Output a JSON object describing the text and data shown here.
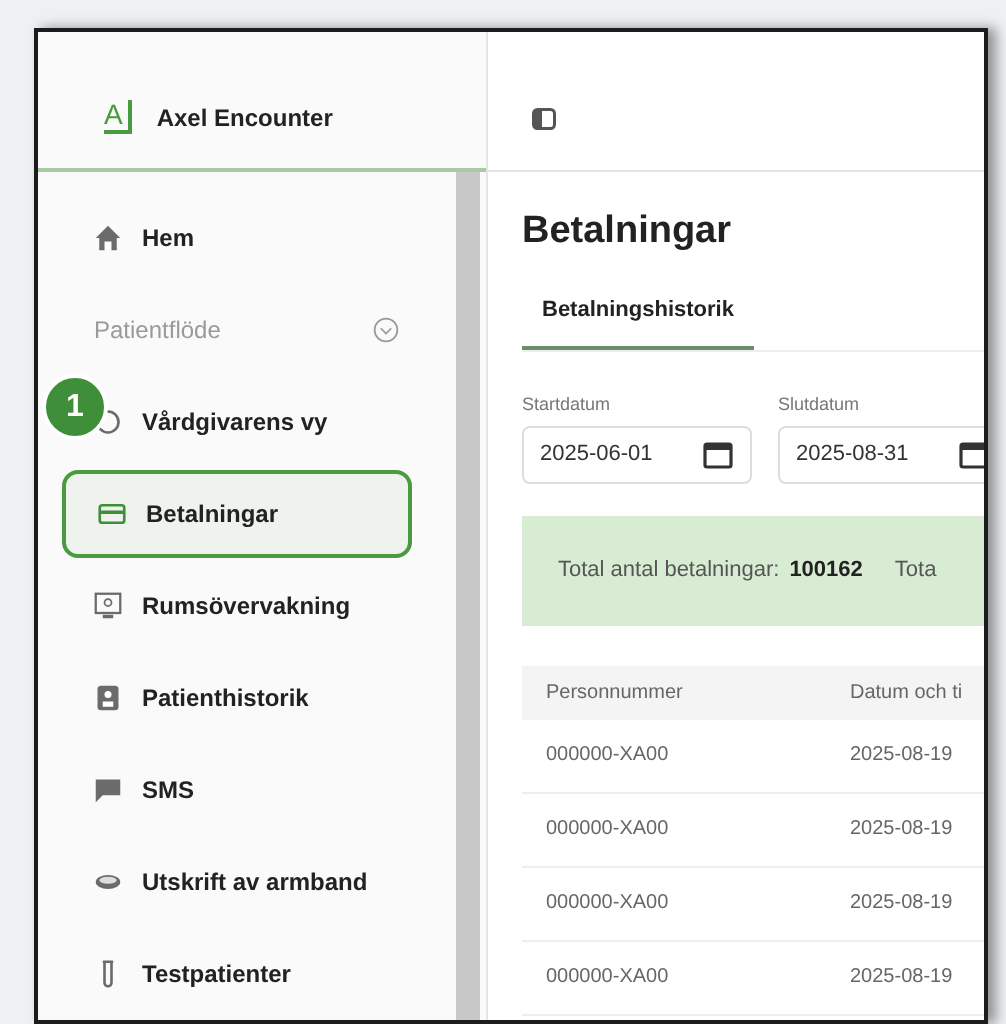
{
  "sidebar": {
    "brand": {
      "mark": "A",
      "name": "Axel Encounter"
    },
    "items": [
      {
        "kind": "link",
        "label": "Hem",
        "selected": false
      },
      {
        "kind": "section",
        "label": "Patientflöde",
        "expanded": true
      },
      {
        "kind": "link",
        "label": "Vårdgivarens vy",
        "selected": false,
        "step": "1"
      },
      {
        "kind": "link",
        "label": "Betalningar",
        "selected": true
      },
      {
        "kind": "link",
        "label": "Rumsövervakning",
        "selected": false
      },
      {
        "kind": "link",
        "label": "Patienthistorik",
        "selected": false
      },
      {
        "kind": "link",
        "label": "SMS",
        "selected": false
      },
      {
        "kind": "link",
        "label": "Utskrift av armband",
        "selected": false
      },
      {
        "kind": "link",
        "label": "Testpatienter",
        "selected": false
      }
    ]
  },
  "page": {
    "title": "Betalningar",
    "tabs": [
      {
        "label": "Betalningshistorik",
        "selected": true
      }
    ],
    "filters": [
      {
        "label": "Startdatum",
        "value": "2025-06-01"
      },
      {
        "label": "Slutdatum",
        "value": "2025-08-31"
      }
    ],
    "summary": [
      {
        "label": "Total antal betalningar:",
        "value": "100162"
      },
      {
        "label": "Tota"
      }
    ],
    "table": {
      "columns": [
        "Personnummer",
        "Datum och ti"
      ],
      "rows": [
        [
          "000000-XA00",
          "2025-08-19"
        ],
        [
          "000000-XA00",
          "2025-08-19"
        ],
        [
          "000000-XA00",
          "2025-08-19"
        ],
        [
          "000000-XA00",
          "2025-08-19"
        ]
      ]
    }
  }
}
